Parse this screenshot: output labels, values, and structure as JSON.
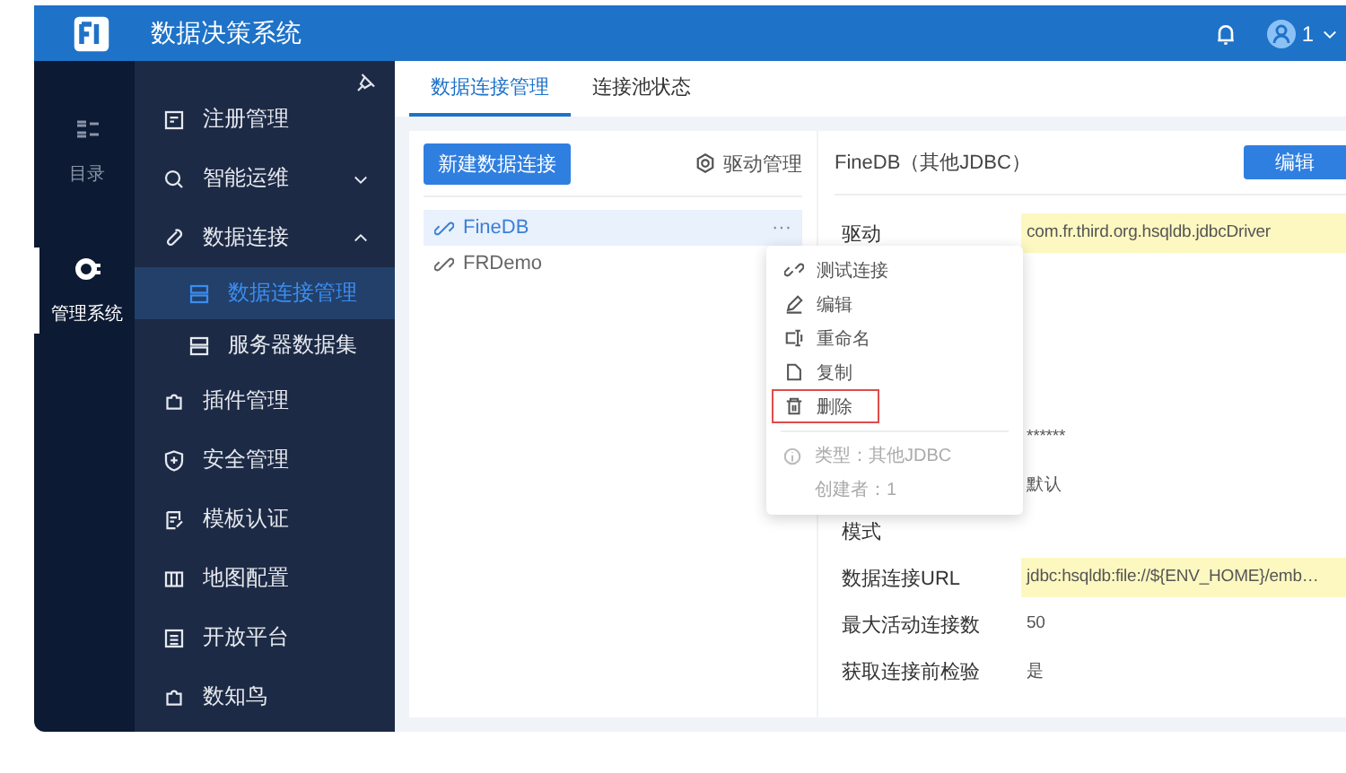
{
  "header": {
    "title": "数据决策系统",
    "user": "1"
  },
  "rail": [
    {
      "label": "目录",
      "selected": false
    },
    {
      "label": "管理系统",
      "selected": true
    }
  ],
  "menu": [
    {
      "kind": "item",
      "label": "注册管理",
      "selected": false
    },
    {
      "kind": "group",
      "label": "智能运维",
      "expanded": false,
      "selected": false
    },
    {
      "kind": "group",
      "label": "数据连接",
      "expanded": true,
      "selected": false,
      "children": [
        {
          "label": "数据连接管理",
          "selected": true
        },
        {
          "label": "服务器数据集",
          "selected": false
        }
      ]
    },
    {
      "kind": "item",
      "label": "插件管理",
      "selected": false
    },
    {
      "kind": "item",
      "label": "安全管理",
      "selected": false
    },
    {
      "kind": "item",
      "label": "模板认证",
      "selected": false
    },
    {
      "kind": "item",
      "label": "地图配置",
      "selected": false
    },
    {
      "kind": "item",
      "label": "开放平台",
      "selected": false
    },
    {
      "kind": "item",
      "label": "数知鸟",
      "selected": false
    }
  ],
  "tabs": [
    {
      "label": "数据连接管理",
      "selected": true
    },
    {
      "label": "连接池状态",
      "selected": false
    }
  ],
  "connections_panel": {
    "new_button": "新建数据连接",
    "driver_button": "驱动管理",
    "more": "···",
    "connections": [
      {
        "name": "FineDB",
        "selected": true
      },
      {
        "name": "FRDemo",
        "selected": false
      }
    ]
  },
  "detail": {
    "title": "FineDB（其他JDBC）",
    "edit_button": "编辑",
    "rows": [
      {
        "label": "驱动",
        "value": "com.fr.third.org.hsqldb.jdbcDriver",
        "highlighted": true
      },
      {
        "value": "******",
        "highlighted": false
      },
      {
        "value": "默认",
        "highlighted": false
      },
      {
        "label": "模式",
        "highlighted": false
      },
      {
        "label": "数据连接URL",
        "value": "jdbc:hsqldb:file://${ENV_HOME}/emb…",
        "highlighted": true
      },
      {
        "label": "最大活动连接数",
        "value": "50",
        "highlighted": false
      },
      {
        "label": "获取连接前检验",
        "value": "是",
        "highlighted": false
      }
    ]
  },
  "context_menu": {
    "items": [
      {
        "label": "测试连接",
        "outlined": false
      },
      {
        "label": "编辑",
        "outlined": false
      },
      {
        "label": "重命名",
        "outlined": false
      },
      {
        "label": "复制",
        "outlined": false
      },
      {
        "label": "删除",
        "outlined": true
      }
    ],
    "info": [
      "类型：其他JDBC",
      "创建者：1"
    ]
  }
}
